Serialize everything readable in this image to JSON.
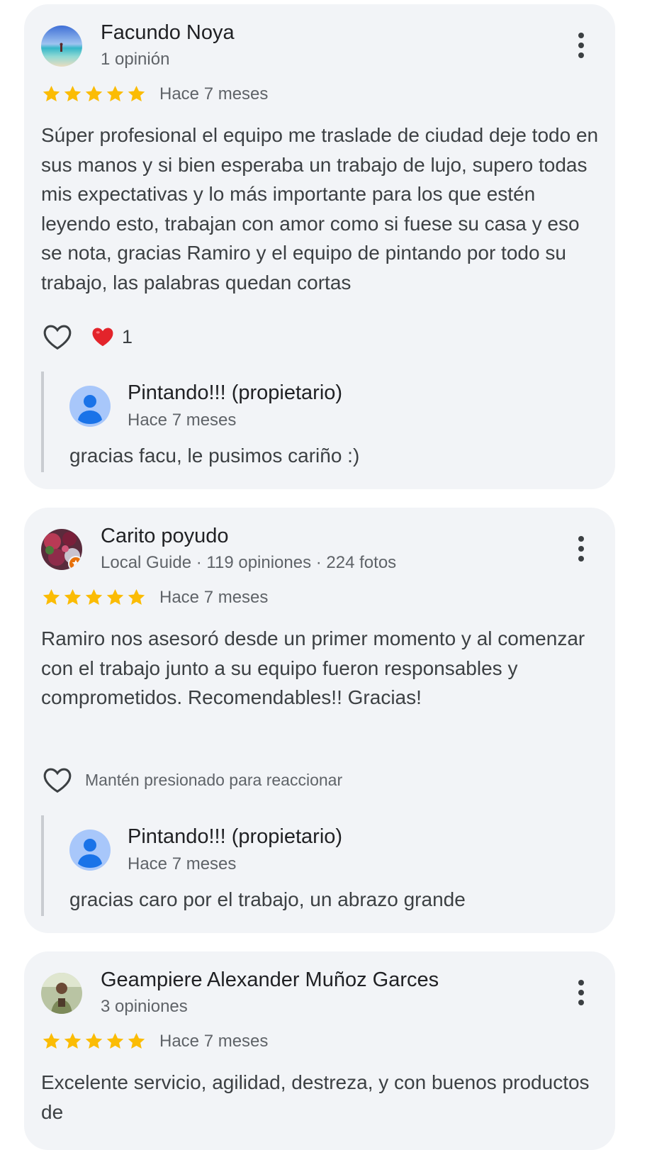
{
  "colors": {
    "card_background": "#f2f4f7",
    "star": "#fbbc04",
    "heart": "#e3242b",
    "owner_avatar_bg": "#a8c7fa",
    "owner_avatar_fg": "#1a73e8",
    "divider": "#c9ccd1"
  },
  "reviews": [
    {
      "author": "Facundo Noya",
      "meta": "1 opinión",
      "avatar_icon": "beach-photo-avatar",
      "stars": 5,
      "date": "Hace 7 meses",
      "text": "Súper profesional el equipo me traslade de ciudad deje todo en sus manos y si bien esperaba un trabajo de lujo, supero todas mis expectativas y lo más importante para los que estén leyendo esto, trabajan con amor como si fuese su casa y eso se nota, gracias Ramiro y el equipo de pintando por todo su trabajo, las palabras quedan cortas",
      "reaction_count": "1",
      "owner_reply": {
        "name": "Pintando!!! (propietario)",
        "date": "Hace 7 meses",
        "text": "gracias facu, le pusimos cariño :)"
      }
    },
    {
      "author": "Carito poyudo",
      "meta": "Local Guide · 119 opiniones · 224 fotos",
      "avatar_icon": "fruit-photo-avatar",
      "stars": 5,
      "date": "Hace 7 meses",
      "text": "Ramiro nos asesoró desde un primer momento y al comenzar con el trabajo junto a su equipo fueron responsables y comprometidos. Recomendables!! Gracias!",
      "reaction_hint": "Mantén presionado para reaccionar",
      "owner_reply": {
        "name": "Pintando!!! (propietario)",
        "date": "Hace 7 meses",
        "text": "gracias caro por el trabajo, un abrazo grande"
      }
    },
    {
      "author": "Geampiere Alexander Muñoz Garces",
      "meta": "3 opiniones",
      "avatar_icon": "person-photo-avatar",
      "stars": 5,
      "date": "Hace 7 meses",
      "text": "Excelente servicio, agilidad, destreza, y con buenos productos de"
    }
  ]
}
